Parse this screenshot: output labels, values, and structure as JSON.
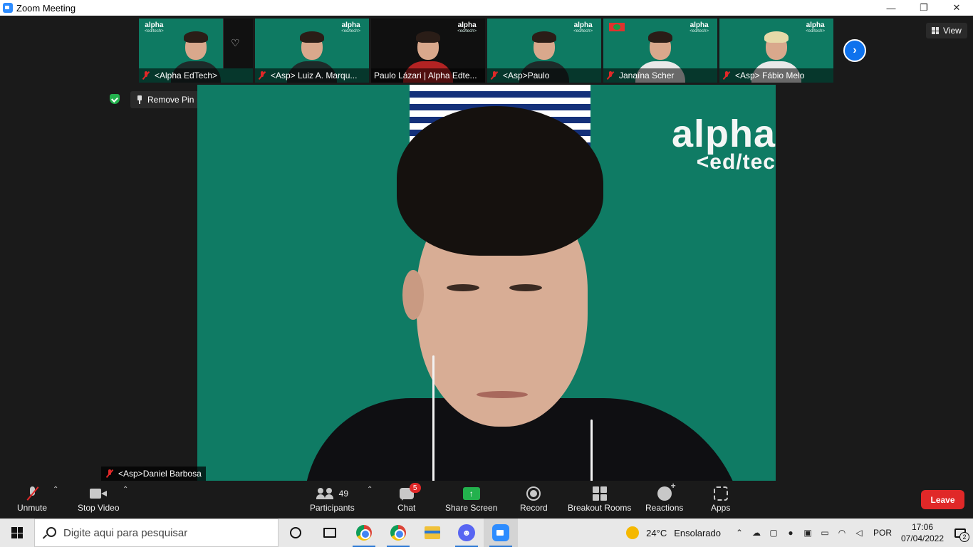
{
  "window": {
    "title": "Zoom Meeting",
    "controls": [
      "—",
      "❐",
      "✕"
    ]
  },
  "view_button": "View",
  "remove_pin": "Remove Pin",
  "thumbnails": [
    {
      "name": "<Alpha EdTech>",
      "logo": "alpha",
      "logo_sub": "<ed/tech>"
    },
    {
      "name": "<Asp> Luiz A. Marqu...",
      "logo": "alpha",
      "logo_sub": "<ed/tech>"
    },
    {
      "name": "Paulo Lázari | Alpha Edte...",
      "logo": "alpha",
      "logo_sub": "<ed/tech>"
    },
    {
      "name": "<Asp>Paulo",
      "logo": "alpha",
      "logo_sub": "<ed/tech>"
    },
    {
      "name": "Janaína Scher",
      "logo": "alpha",
      "logo_sub": "<ed/tech>"
    },
    {
      "name": "<Asp> Fábio Melo",
      "logo": "alpha",
      "logo_sub": "<ed/tech>"
    }
  ],
  "main_video": {
    "speaker_name": "<Asp>Daniel Barbosa",
    "brand": "alpha",
    "brand_sub": "<ed/tec"
  },
  "toolbar": {
    "unmute": "Unmute",
    "stop_video": "Stop Video",
    "participants": "Participants",
    "participant_count": "49",
    "chat": "Chat",
    "chat_badge": "5",
    "share_screen": "Share Screen",
    "record": "Record",
    "breakout_rooms": "Breakout Rooms",
    "reactions": "Reactions",
    "apps": "Apps",
    "leave": "Leave"
  },
  "taskbar": {
    "search_placeholder": "Digite aqui para pesquisar",
    "weather_temp": "24°C",
    "weather_desc": "Ensolarado",
    "language": "POR",
    "time": "17:06",
    "date": "07/04/2022",
    "notifications": "2"
  }
}
